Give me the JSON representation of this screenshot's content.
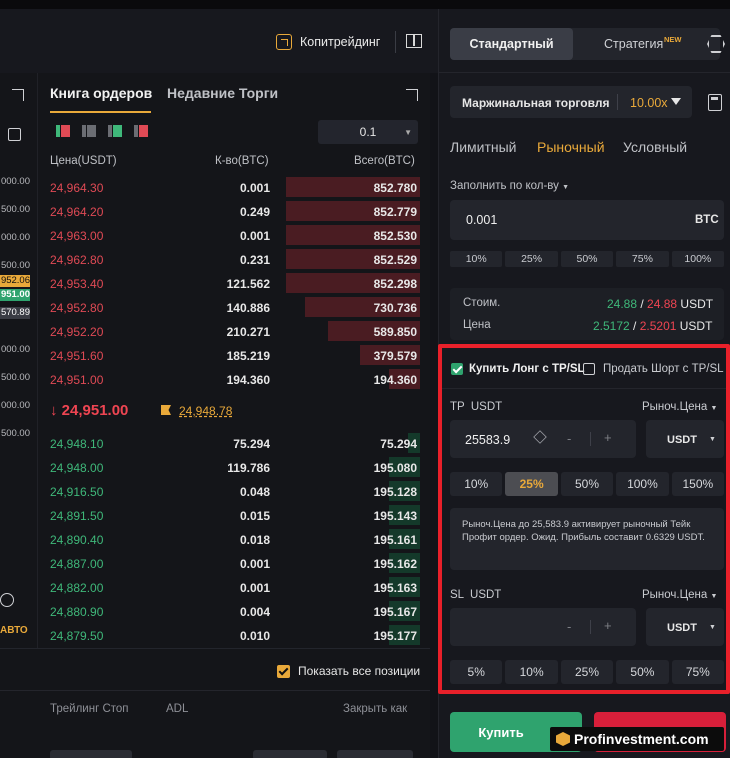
{
  "header": {
    "copytrading": "Копитрейдинг"
  },
  "left_column": {
    "values": [
      "000.00",
      "500.00",
      "000.00",
      "500.00",
      "952.06",
      "951.00",
      "570.89",
      "000.00",
      "500.00",
      "000.00",
      "500.00"
    ],
    "auto_label": "авто"
  },
  "orderbook": {
    "tab_active": "Книга ордеров",
    "tab_inactive": "Недавние Торги",
    "precision": "0.1",
    "col_price": "Цена(USDT)",
    "col_qty": "К-во(BTC)",
    "col_total": "Всего(BTC)",
    "asks": [
      {
        "price": "24,964.30",
        "qty": "0.001",
        "total": "852.780",
        "depth": 1.0
      },
      {
        "price": "24,964.20",
        "qty": "0.249",
        "total": "852.779",
        "depth": 1.0
      },
      {
        "price": "24,963.00",
        "qty": "0.001",
        "total": "852.530",
        "depth": 1.0
      },
      {
        "price": "24,962.80",
        "qty": "0.231",
        "total": "852.529",
        "depth": 1.0
      },
      {
        "price": "24,953.40",
        "qty": "121.562",
        "total": "852.298",
        "depth": 1.0
      },
      {
        "price": "24,952.80",
        "qty": "140.886",
        "total": "730.736",
        "depth": 0.86
      },
      {
        "price": "24,952.20",
        "qty": "210.271",
        "total": "589.850",
        "depth": 0.69
      },
      {
        "price": "24,951.60",
        "qty": "185.219",
        "total": "379.579",
        "depth": 0.45
      },
      {
        "price": "24,951.00",
        "qty": "194.360",
        "total": "194.360",
        "depth": 0.23
      }
    ],
    "last_price": "24,951.00",
    "mark_price": "24,948.78",
    "bids": [
      {
        "price": "24,948.10",
        "qty": "75.294",
        "total": "75.294",
        "depth": 0.09
      },
      {
        "price": "24,948.00",
        "qty": "119.786",
        "total": "195.080",
        "depth": 0.23
      },
      {
        "price": "24,916.50",
        "qty": "0.048",
        "total": "195.128",
        "depth": 0.23
      },
      {
        "price": "24,891.50",
        "qty": "0.015",
        "total": "195.143",
        "depth": 0.23
      },
      {
        "price": "24,890.40",
        "qty": "0.018",
        "total": "195.161",
        "depth": 0.23
      },
      {
        "price": "24,887.00",
        "qty": "0.001",
        "total": "195.162",
        "depth": 0.23
      },
      {
        "price": "24,882.00",
        "qty": "0.001",
        "total": "195.163",
        "depth": 0.23
      },
      {
        "price": "24,880.90",
        "qty": "0.004",
        "total": "195.167",
        "depth": 0.23
      },
      {
        "price": "24,879.50",
        "qty": "0.010",
        "total": "195.177",
        "depth": 0.23
      }
    ]
  },
  "bottom": {
    "show_all": "Показать все позиции",
    "col_trailing": "Трейлинг Стоп",
    "col_adl": "ADL",
    "col_close": "Закрыть как"
  },
  "panel": {
    "seg_standard": "Стандартный",
    "seg_strategy": "Стратегия",
    "new_badge": "NEW",
    "margin_label": "Маржинальная торговля",
    "leverage": "10.00x",
    "order_types": [
      "Лимитный",
      "Рыночный",
      "Условный"
    ],
    "fill_by_qty": "Заполнить по кол-ву",
    "qty_value": "0.001",
    "qty_unit": "BTC",
    "qty_pcts": [
      "10%",
      "25%",
      "50%",
      "75%",
      "100%"
    ],
    "cost_label": "Стоим.",
    "cost_buy": "24.88",
    "cost_sell": "24.88",
    "cost_unit": "USDT",
    "price_label": "Цена",
    "price_buy": "2.5172",
    "price_sell": "2.5201",
    "price_unit": "USDT",
    "buy_long_tpsl": "Купить Лонг с TP/SL",
    "sell_short_tpsl": "Продать Шорт с TP/SL",
    "tp_label": "TP  USDT",
    "tp_trigger": "Рыноч.Цена",
    "tp_value": "25583.9",
    "tp_unit": "USDT",
    "tp_pcts": [
      "10%",
      "25%",
      "50%",
      "100%",
      "150%"
    ],
    "tp_info": "Рыноч.Цена до 25,583.9 активирует рыночный Тейк Профит ордер. Ожид. Прибыль составит 0.6329 USDT.",
    "sl_label": "SL  USDT",
    "sl_trigger": "Рыноч.Цена",
    "sl_unit": "USDT",
    "sl_pcts": [
      "5%",
      "10%",
      "25%",
      "50%",
      "75%"
    ],
    "buy_button": "Купить",
    "watermark": "Profinvestment.com"
  }
}
